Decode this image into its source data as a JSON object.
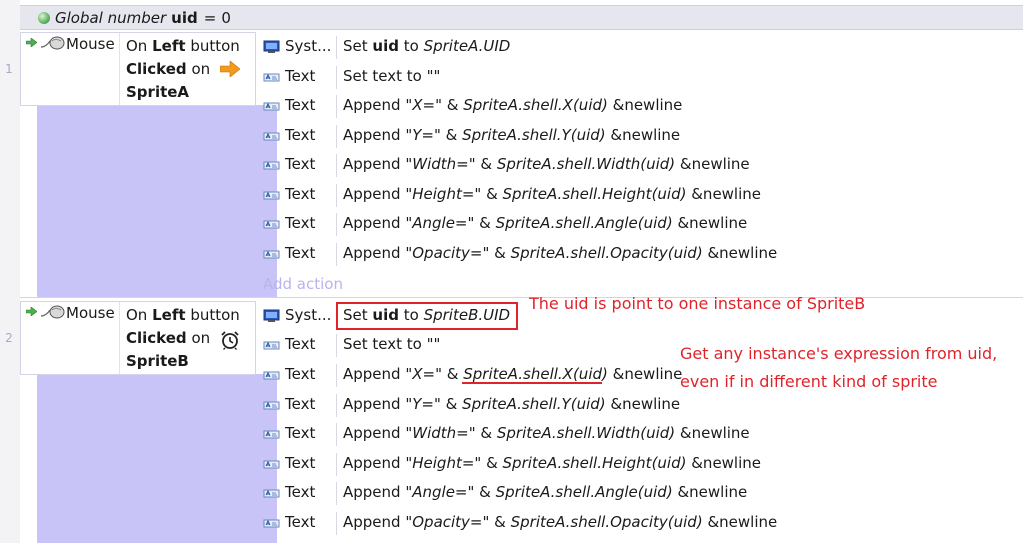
{
  "global_var": {
    "prefix": "Global number",
    "name": "uid",
    "equals": "=",
    "value": "0"
  },
  "events": [
    {
      "number": "1",
      "condition": {
        "object": "Mouse",
        "on": "On",
        "button": "Left",
        "button_suffix": "button",
        "clicked": "Clicked",
        "clicked_on": "on",
        "target": "SpriteA"
      },
      "actions": [
        {
          "object": "Syst...",
          "icon": "system-icon",
          "parts": [
            "Set ",
            "uid",
            " to ",
            "SpriteA.UID"
          ]
        },
        {
          "object": "Text",
          "icon": "text-object-icon",
          "parts": [
            "Set text to \"\""
          ]
        },
        {
          "object": "Text",
          "icon": "text-object-icon",
          "parts": [
            "Append ",
            "\"X=\"",
            " & ",
            "SpriteA.shell.X(uid)",
            " &newline"
          ]
        },
        {
          "object": "Text",
          "icon": "text-object-icon",
          "parts": [
            "Append ",
            "\"Y=\"",
            " & ",
            "SpriteA.shell.Y(uid)",
            " &newline"
          ]
        },
        {
          "object": "Text",
          "icon": "text-object-icon",
          "parts": [
            "Append ",
            "\"Width=\"",
            " & ",
            "SpriteA.shell.Width(uid)",
            " &newline"
          ]
        },
        {
          "object": "Text",
          "icon": "text-object-icon",
          "parts": [
            "Append ",
            "\"Height=\"",
            " & ",
            "SpriteA.shell.Height(uid)",
            " &newline"
          ]
        },
        {
          "object": "Text",
          "icon": "text-object-icon",
          "parts": [
            "Append ",
            "\"Angle=\"",
            " & ",
            "SpriteA.shell.Angle(uid)",
            " &newline"
          ]
        },
        {
          "object": "Text",
          "icon": "text-object-icon",
          "parts": [
            "Append ",
            "\"Opacity=\"",
            " & ",
            "SpriteA.shell.Opacity(uid)",
            " &newline"
          ]
        }
      ],
      "add_action": "Add action"
    },
    {
      "number": "2",
      "condition": {
        "object": "Mouse",
        "on": "On",
        "button": "Left",
        "button_suffix": "button",
        "clicked": "Clicked",
        "clicked_on": "on",
        "target": "SpriteB"
      },
      "actions": [
        {
          "object": "Syst...",
          "icon": "system-icon",
          "parts": [
            "Set ",
            "uid",
            " to ",
            "SpriteB.UID"
          ]
        },
        {
          "object": "Text",
          "icon": "text-object-icon",
          "parts": [
            "Set text to \"\""
          ]
        },
        {
          "object": "Text",
          "icon": "text-object-icon",
          "parts": [
            "Append ",
            "\"X=\"",
            " & ",
            "SpriteA.shell.X(uid)",
            " &newline"
          ]
        },
        {
          "object": "Text",
          "icon": "text-object-icon",
          "parts": [
            "Append ",
            "\"Y=\"",
            " & ",
            "SpriteA.shell.Y(uid)",
            " &newline"
          ]
        },
        {
          "object": "Text",
          "icon": "text-object-icon",
          "parts": [
            "Append ",
            "\"Width=\"",
            " & ",
            "SpriteA.shell.Width(uid)",
            " &newline"
          ]
        },
        {
          "object": "Text",
          "icon": "text-object-icon",
          "parts": [
            "Append ",
            "\"Height=\"",
            " & ",
            "SpriteA.shell.Height(uid)",
            " &newline"
          ]
        },
        {
          "object": "Text",
          "icon": "text-object-icon",
          "parts": [
            "Append ",
            "\"Angle=\"",
            " & ",
            "SpriteA.shell.Angle(uid)",
            " &newline"
          ]
        },
        {
          "object": "Text",
          "icon": "text-object-icon",
          "parts": [
            "Append ",
            "\"Opacity=\"",
            " & ",
            "SpriteA.shell.Opacity(uid)",
            " &newline"
          ]
        }
      ]
    }
  ],
  "annotations": {
    "note1": "The uid is point to one instance of SpriteB",
    "note2_line1": "Get any instance's expression from uid,",
    "note2_line2": "even if in different kind of sprite"
  },
  "colors": {
    "event_strip": "#c9c4f7",
    "annotation_red": "#e0232a",
    "add_action_text": "#b7b3ef"
  }
}
